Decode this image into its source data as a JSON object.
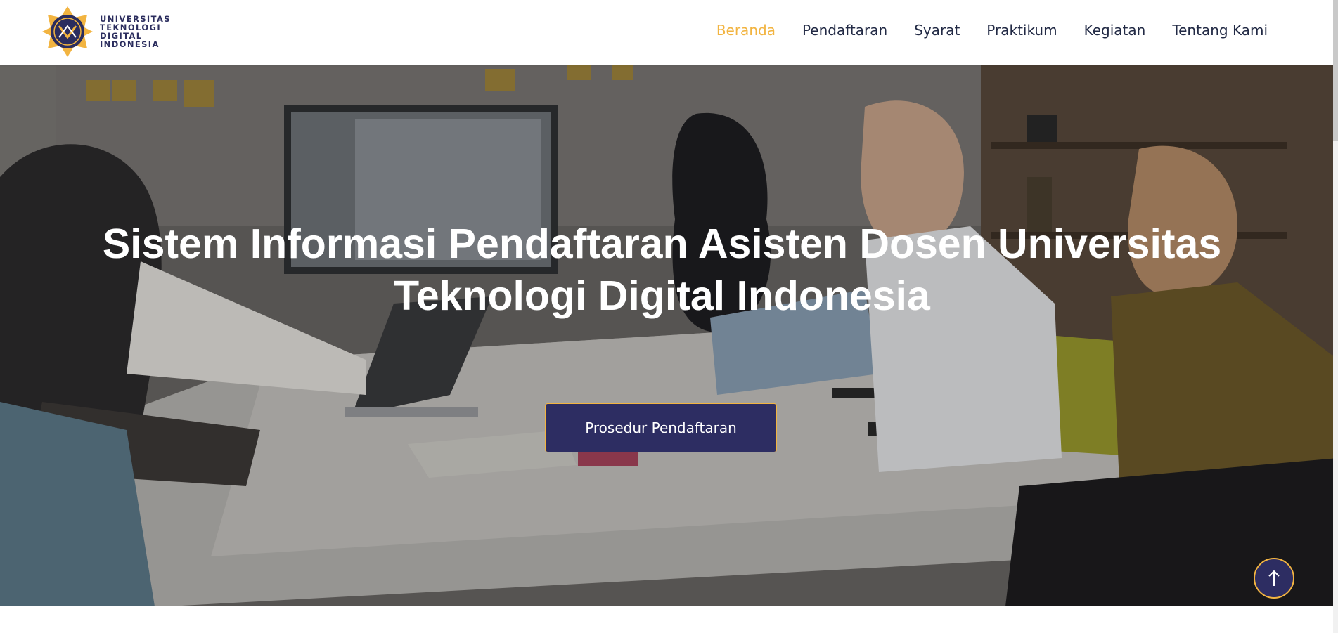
{
  "header": {
    "logo": {
      "lines": [
        "UNIVERSITAS",
        "TEKNOLOGI",
        "DIGITAL",
        "INDONESIA"
      ],
      "colors": {
        "navy": "#2b2d5e",
        "gold": "#f2b441"
      }
    },
    "nav": [
      {
        "label": "Beranda",
        "active": true
      },
      {
        "label": "Pendaftaran",
        "active": false
      },
      {
        "label": "Syarat",
        "active": false
      },
      {
        "label": "Praktikum",
        "active": false
      },
      {
        "label": "Kegiatan",
        "active": false
      },
      {
        "label": "Tentang Kami",
        "active": false
      }
    ]
  },
  "hero": {
    "title_line1": "Sistem Informasi Pendaftaran Asisten Dosen Universitas",
    "title_line2": "Teknologi Digital Indonesia",
    "cta_label": "Prosedur Pendaftaran",
    "background_image": "office-meeting-photo",
    "scroll_top_icon": "arrow-up-icon"
  },
  "theme": {
    "accent": "#f2b441",
    "primary": "#2d2d62",
    "nav_text": "#222a45"
  }
}
